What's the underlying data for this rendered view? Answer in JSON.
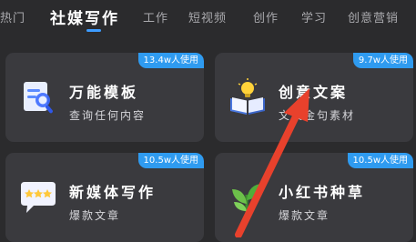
{
  "tabs": [
    {
      "label": "热门"
    },
    {
      "label": "社媒写作",
      "active": true
    },
    {
      "label": "工作"
    },
    {
      "label": "短视频"
    },
    {
      "label": "创作"
    },
    {
      "label": "学习"
    },
    {
      "label": "创意营销"
    }
  ],
  "cards": [
    {
      "title": "万能模板",
      "subtitle": "查询任何内容",
      "usage": "13.4w人使用",
      "icon": "search-template-icon"
    },
    {
      "title": "创意文案",
      "subtitle": "文案金句素材",
      "usage": "9.7w人使用",
      "icon": "book-lightbulb-icon"
    },
    {
      "title": "新媒体写作",
      "subtitle": "爆款文章",
      "usage": "10.5w人使用",
      "icon": "chat-stars-icon"
    },
    {
      "title": "小红书种草",
      "subtitle": "爆款文章",
      "usage": "10.5w人使用",
      "icon": "leaf-icon"
    }
  ],
  "colors": {
    "accent": "#3d9cff",
    "badge": "#2f9bf0",
    "card": "#3a3a3e",
    "background": "#2b2b2d",
    "arrow": "#e8412c"
  }
}
